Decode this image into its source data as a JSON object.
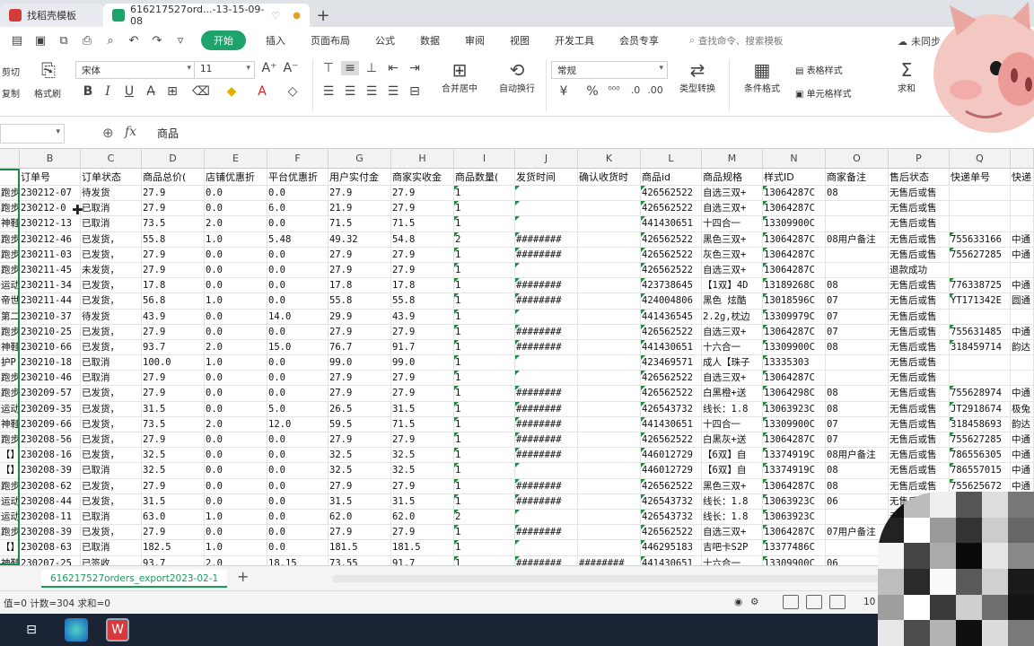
{
  "tabs": [
    {
      "label": "找稻壳模板",
      "icon_color": "#d63a3a"
    },
    {
      "label": "616217527ord...-13-15-09-08",
      "icon_color": "#1ea36b"
    }
  ],
  "menu": {
    "items": [
      "开始",
      "插入",
      "页面布局",
      "公式",
      "数据",
      "审阅",
      "视图",
      "开发工具",
      "会员专享"
    ],
    "search": "查找命令、搜索模板",
    "cloud": "未同步"
  },
  "ribbon": {
    "cut": "剪切",
    "paste": "粘贴",
    "copy": "复制",
    "format_painter": "格式刷",
    "font": "宋体",
    "font_size": "11",
    "bold": "B",
    "italic": "I",
    "underline": "U",
    "merge": "合并居中",
    "wrap": "自动换行",
    "number_format": "常规",
    "currency": "¥",
    "percent": "%",
    "type_convert": "类型转换",
    "cond_format": "条件格式",
    "table_style": "表格样式",
    "cell_style": "单元格样式",
    "sum": "求和",
    "sum_icon": "Σ"
  },
  "formula_bar": {
    "fx": "fx",
    "content": "商品"
  },
  "columns": [
    "",
    "B",
    "C",
    "D",
    "E",
    "F",
    "G",
    "H",
    "I",
    "J",
    "K",
    "L",
    "M",
    "N",
    "O",
    "P",
    "Q",
    ""
  ],
  "header_row": [
    "",
    "订单号",
    "订单状态",
    "商品总价(",
    "店铺优惠折",
    "平台优惠折",
    "用户实付金",
    "商家实收金",
    "商品数量(",
    "发货时间",
    "确认收货时",
    "商品id",
    "商品规格",
    "样式ID",
    "商家备注",
    "售后状态",
    "快递单号",
    "快递"
  ],
  "rows": [
    [
      "跑步",
      "230212-07",
      "待发货",
      "27.9",
      "0.0",
      "0.0",
      "27.9",
      "27.9",
      "1",
      "",
      "",
      "426562522",
      "自选三双+",
      "13064287C",
      "08",
      "无售后或售",
      "",
      ""
    ],
    [
      "跑步",
      "230212-0",
      "已取消",
      "27.9",
      "0.0",
      "6.0",
      "21.9",
      "27.9",
      "1",
      "",
      "",
      "426562522",
      "自选三双+",
      "13064287C",
      "",
      "无售后或售",
      "",
      ""
    ],
    [
      "神鞋",
      "230212-13",
      "已取消",
      "73.5",
      "2.0",
      "0.0",
      "71.5",
      "71.5",
      "1",
      "",
      "",
      "441430651",
      "十四合一",
      "13309900C",
      "",
      "无售后或售",
      "",
      ""
    ],
    [
      "跑步",
      "230212-46",
      "已发货，",
      "55.8",
      "1.0",
      "5.48",
      "49.32",
      "54.8",
      "2",
      "########",
      "",
      "426562522",
      "黑色三双+",
      "13064287C",
      "08用户备注",
      "无售后或售",
      "755633166",
      "中通"
    ],
    [
      "跑步",
      "230211-03",
      "已发货，",
      "27.9",
      "0.0",
      "0.0",
      "27.9",
      "27.9",
      "1",
      "########",
      "",
      "426562522",
      "灰色三双+",
      "13064287C",
      "",
      "无售后或售",
      "755627285",
      "中通"
    ],
    [
      "跑步",
      "230211-45",
      "未发货，",
      "27.9",
      "0.0",
      "0.0",
      "27.9",
      "27.9",
      "1",
      "",
      "",
      "426562522",
      "自选三双+",
      "13064287C",
      "",
      "退款成功",
      "",
      ""
    ],
    [
      "运动",
      "230211-34",
      "已发货，",
      "17.8",
      "0.0",
      "0.0",
      "17.8",
      "17.8",
      "1",
      "########",
      "",
      "423738645",
      "【1双】4D",
      "13189268C",
      "08",
      "无售后或售",
      "776338725",
      "中通"
    ],
    [
      "帝世",
      "230211-44",
      "已发货，",
      "56.8",
      "1.0",
      "0.0",
      "55.8",
      "55.8",
      "1",
      "########",
      "",
      "424004806",
      "黑色 炫酷",
      "13018596C",
      "07",
      "无售后或售",
      "YT171342E",
      "圆通"
    ],
    [
      "第二",
      "230210-37",
      "待发货",
      "43.9",
      "0.0",
      "14.0",
      "29.9",
      "43.9",
      "1",
      "",
      "",
      "441436545",
      "2.2g,枕边",
      "13309979C",
      "07",
      "无售后或售",
      "",
      ""
    ],
    [
      "跑步",
      "230210-25",
      "已发货，",
      "27.9",
      "0.0",
      "0.0",
      "27.9",
      "27.9",
      "1",
      "########",
      "",
      "426562522",
      "自选三双+",
      "13064287C",
      "07",
      "无售后或售",
      "755631485",
      "中通"
    ],
    [
      "神鞋",
      "230210-66",
      "已发货，",
      "93.7",
      "2.0",
      "15.0",
      "76.7",
      "91.7",
      "1",
      "########",
      "",
      "441430651",
      "十六合一",
      "13309900C",
      "08",
      "无售后或售",
      "318459714",
      "韵达"
    ],
    [
      "护P",
      "230210-18",
      "已取消",
      "100.0",
      "1.0",
      "0.0",
      "99.0",
      "99.0",
      "1",
      "",
      "",
      "423469571",
      "成人【珠子",
      "13335303",
      "",
      "无售后或售",
      "",
      ""
    ],
    [
      "跑步",
      "230210-46",
      "已取消",
      "27.9",
      "0.0",
      "0.0",
      "27.9",
      "27.9",
      "1",
      "",
      "",
      "426562522",
      "自选三双+",
      "13064287C",
      "",
      "无售后或售",
      "",
      ""
    ],
    [
      "跑步",
      "230209-57",
      "已发货，",
      "27.9",
      "0.0",
      "0.0",
      "27.9",
      "27.9",
      "1",
      "########",
      "",
      "426562522",
      "白黑橙+送",
      "13064298C",
      "08",
      "无售后或售",
      "755628974",
      "中通"
    ],
    [
      "运动",
      "230209-35",
      "已发货，",
      "31.5",
      "0.0",
      "5.0",
      "26.5",
      "31.5",
      "1",
      "########",
      "",
      "426543732",
      "线长：1.8",
      "13063923C",
      "08",
      "无售后或售",
      "JT2918674",
      "极兔"
    ],
    [
      "神鞋",
      "230209-66",
      "已发货，",
      "73.5",
      "2.0",
      "12.0",
      "59.5",
      "71.5",
      "1",
      "########",
      "",
      "441430651",
      "十四合一",
      "13309900C",
      "07",
      "无售后或售",
      "318458693",
      "韵达"
    ],
    [
      "跑步",
      "230208-56",
      "已发货，",
      "27.9",
      "0.0",
      "0.0",
      "27.9",
      "27.9",
      "1",
      "########",
      "",
      "426562522",
      "白黑灰+送",
      "13064287C",
      "07",
      "无售后或售",
      "755627285",
      "中通"
    ],
    [
      "【】",
      "230208-16",
      "已发货，",
      "32.5",
      "0.0",
      "0.0",
      "32.5",
      "32.5",
      "1",
      "########",
      "",
      "446012729",
      "【6双】自",
      "13374919C",
      "08用户备注",
      "无售后或售",
      "786556305",
      "中通"
    ],
    [
      "【】",
      "230208-39",
      "已取消",
      "32.5",
      "0.0",
      "0.0",
      "32.5",
      "32.5",
      "1",
      "",
      "",
      "446012729",
      "【6双】自",
      "13374919C",
      "08",
      "无售后或售",
      "786557015",
      "中通"
    ],
    [
      "跑步",
      "230208-62",
      "已发货，",
      "27.9",
      "0.0",
      "0.0",
      "27.9",
      "27.9",
      "1",
      "########",
      "",
      "426562522",
      "黑色三双+",
      "13064287C",
      "08",
      "无售后或售",
      "755625672",
      "中通"
    ],
    [
      "运动",
      "230208-44",
      "已发货，",
      "31.5",
      "0.0",
      "0.0",
      "31.5",
      "31.5",
      "1",
      "########",
      "",
      "426543732",
      "线长：1.8",
      "13063923C",
      "06",
      "无售后或售",
      "JT291862E",
      "极兔"
    ],
    [
      "运动",
      "230208-11",
      "已取消",
      "63.0",
      "1.0",
      "0.0",
      "62.0",
      "62.0",
      "2",
      "",
      "",
      "426543732",
      "线长：1.8",
      "13063923C",
      "",
      "无售后或售",
      "",
      ""
    ],
    [
      "跑步",
      "230208-39",
      "已发货，",
      "27.9",
      "0.0",
      "0.0",
      "27.9",
      "27.9",
      "1",
      "########",
      "",
      "426562522",
      "自选三双+",
      "13064287C",
      "07用户备注",
      "无售后或售",
      "",
      ""
    ],
    [
      "【】",
      "230208-63",
      "已取消",
      "182.5",
      "1.0",
      "0.0",
      "181.5",
      "181.5",
      "1",
      "",
      "",
      "446295183",
      "吉吧卡S2P",
      "13377486C",
      "",
      "无售后或售",
      "",
      ""
    ],
    [
      "神鞋",
      "230207-25",
      "已签收",
      "93.7",
      "2.0",
      "18.15",
      "73.55",
      "91.7",
      "1",
      "########",
      "########",
      "441430651",
      "十六合一",
      "13309900C",
      "06",
      "无售后或售",
      "",
      ""
    ]
  ],
  "sheet": {
    "tab": "616217527orders_export2023-02-1",
    "add": "+"
  },
  "status": {
    "text": "值=0  计数=304  求和=0",
    "zoom": "10"
  },
  "colors": {
    "accent": "#1ea36b",
    "grid_header": "#f2f2f2",
    "taskbar": "#1a2434"
  },
  "taskbar": {
    "apps": [
      "task-view",
      "edge",
      "wps"
    ]
  }
}
